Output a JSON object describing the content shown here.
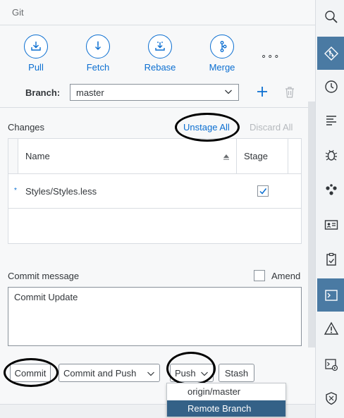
{
  "panel": {
    "title": "Git"
  },
  "toolbar": {
    "items": [
      {
        "label": "Pull",
        "icon": "pull-icon"
      },
      {
        "label": "Fetch",
        "icon": "fetch-icon"
      },
      {
        "label": "Rebase",
        "icon": "rebase-icon"
      },
      {
        "label": "Merge",
        "icon": "merge-icon"
      }
    ],
    "more_label": "∘∘∘"
  },
  "branch": {
    "label": "Branch:",
    "value": "master"
  },
  "changes": {
    "label": "Changes",
    "unstage_all": "Unstage All",
    "discard_all": "Discard All",
    "columns": {
      "name": "Name",
      "stage": "Stage"
    },
    "rows": [
      {
        "mark": "*",
        "name": "Styles/Styles.less",
        "staged": true
      }
    ]
  },
  "commit": {
    "message_label": "Commit message",
    "amend_label": "Amend",
    "message": "Commit Update"
  },
  "actions": {
    "commit": "Commit",
    "commit_and_push": "Commit and Push",
    "push": "Push",
    "stash": "Stash"
  },
  "push_menu": {
    "items": [
      "origin/master",
      "Remote Branch"
    ],
    "highlighted": "Remote Branch"
  },
  "rightbar": {
    "items": [
      "search-icon",
      "git-icon",
      "history-icon",
      "outline-icon",
      "debug-icon",
      "dependencies-icon",
      "contact-card-icon",
      "checklist-icon",
      "terminal-icon",
      "warning-icon",
      "run-console-icon",
      "security-icon"
    ],
    "active": "git-icon",
    "accent_color": "#4a7aa3"
  },
  "colors": {
    "link": "#0a6ed1",
    "selected_item": "#346187"
  }
}
